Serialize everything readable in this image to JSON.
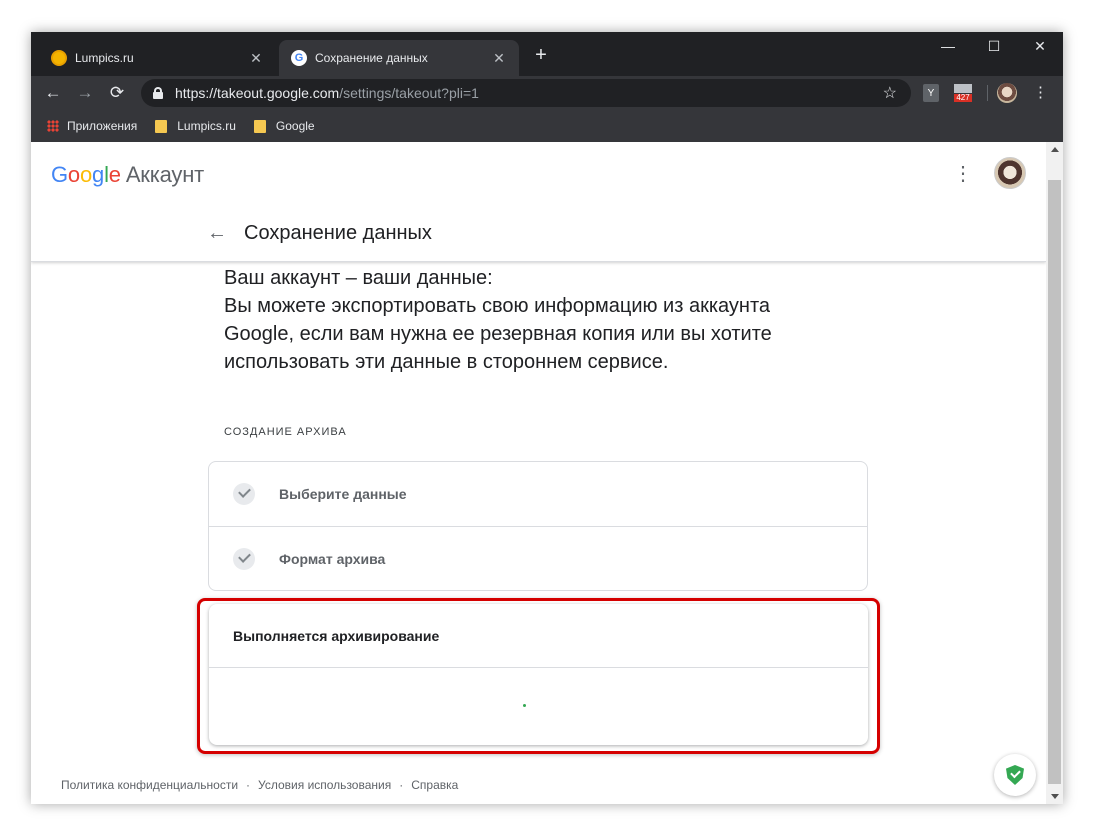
{
  "browser": {
    "tabs": [
      {
        "title": "Lumpics.ru",
        "favicon": "lumpics-favicon",
        "active": false
      },
      {
        "title": "Сохранение данных",
        "favicon": "google-favicon",
        "active": true
      }
    ],
    "new_tab_icon": "+",
    "window_controls": {
      "minimize": "—",
      "maximize": "☐",
      "close": "✕"
    },
    "url": {
      "scheme": "https://",
      "host": "takeout.google.com",
      "path": "/settings/takeout?pli=1"
    },
    "extensions": [
      {
        "name": "yandex-extension",
        "label": "Y"
      },
      {
        "name": "mail-extension",
        "badge": "427"
      }
    ],
    "bookmarks": [
      {
        "label": "Приложения",
        "icon": "apps-grid-icon"
      },
      {
        "label": "Lumpics.ru",
        "icon": "folder-icon"
      },
      {
        "label": "Google",
        "icon": "folder-icon"
      }
    ]
  },
  "header": {
    "logo_letters": [
      "G",
      "o",
      "o",
      "g",
      "l",
      "e"
    ],
    "logo_suffix": "Аккаунт",
    "page_title": "Сохранение данных"
  },
  "main": {
    "intro_lines": [
      "Ваш аккаунт – ваши данные:",
      "Вы можете экспортировать свою информацию из аккаунта",
      "Google, если вам нужна ее резервная копия или вы хотите",
      "использовать эти данные в стороннем сервисе."
    ],
    "section_label": "СОЗДАНИЕ АРХИВА",
    "steps": [
      {
        "label": "Выберите данные",
        "status": "done"
      },
      {
        "label": "Формат архива",
        "status": "done"
      }
    ],
    "progress": {
      "title": "Выполняется архивирование"
    }
  },
  "footer": {
    "links": [
      "Политика конфиденциальности",
      "Условия использования",
      "Справка"
    ],
    "separator": "·"
  },
  "colors": {
    "highlight": "#d50000",
    "spinner": "#34a853",
    "shield": "#34a853"
  }
}
